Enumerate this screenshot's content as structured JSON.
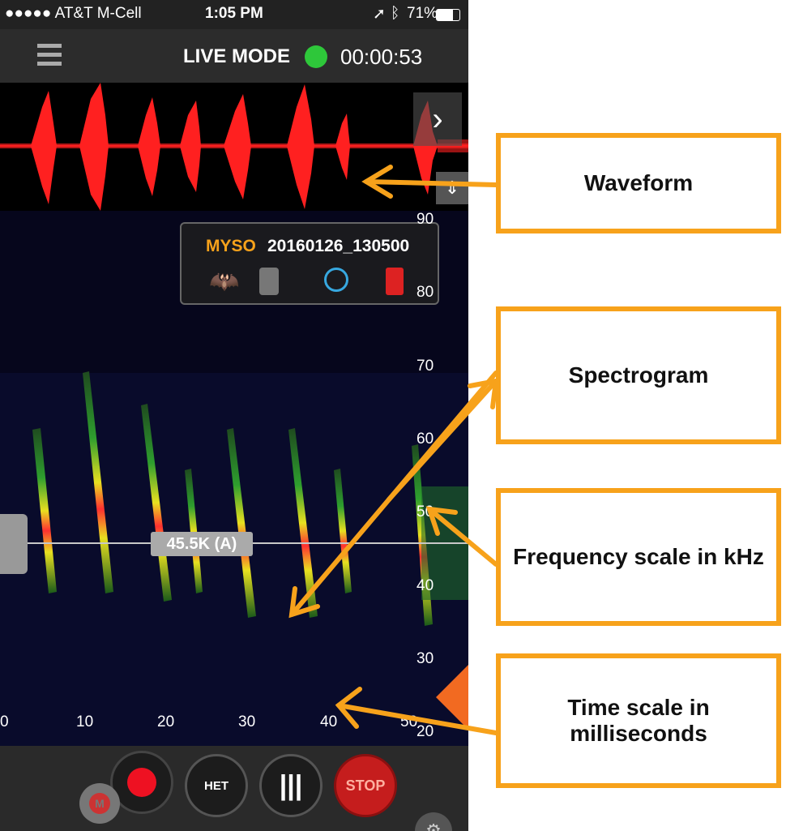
{
  "status_bar": {
    "carrier": "●●●●● AT&T M-Cell",
    "time": "1:05 PM",
    "battery": "71%"
  },
  "top_bar": {
    "mode_label": "LIVE MODE",
    "timer": "00:00:53",
    "menu_icon": "hamburger-icon",
    "status_color": "#2ec73a"
  },
  "info_panel": {
    "species": "MYSO",
    "filename": "20160126_130500"
  },
  "marker": {
    "label": "45.5K (A)"
  },
  "frequency_scale": {
    "unit": "kHz",
    "labels": [
      "90",
      "80",
      "70",
      "60",
      "50",
      "40",
      "30",
      "20"
    ]
  },
  "time_scale": {
    "unit": "ms",
    "labels": [
      "0",
      "10",
      "20",
      "30",
      "40",
      "50"
    ]
  },
  "controls": {
    "m_label": "M",
    "het_label": "HET",
    "stop_label": "STOP"
  },
  "callouts": {
    "waveform": "Waveform",
    "spectrogram": "Spectrogram",
    "frequency": "Frequency scale in kHz",
    "time_line1": "Time scale in",
    "time_line2": "milliseconds"
  },
  "colors": {
    "accent": "#f7a21b",
    "waveform": "#ff2020",
    "stop": "#c51d1d",
    "species": "#f7a21b"
  }
}
